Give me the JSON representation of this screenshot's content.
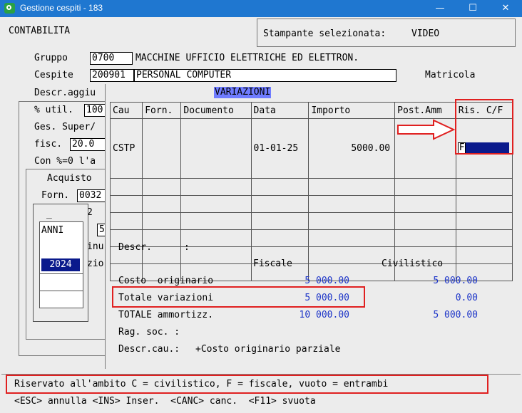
{
  "window": {
    "title": "Gestione cespiti - 183",
    "minimize_glyph": "—",
    "maximize_glyph": "☐",
    "close_glyph": "✕"
  },
  "header": {
    "section": "CONTABILITA",
    "printer_label": "Stampante selezionata:",
    "printer_value": "VIDEO"
  },
  "form": {
    "gruppo_label": "Gruppo",
    "gruppo_code": "0700",
    "gruppo_desc": "MACCHINE UFFICIO ELETTRICHE ED ELETTRON.",
    "cespite_label": "Cespite",
    "cespite_code": "200901",
    "cespite_desc": "PERSONAL COMPUTER",
    "matricola_label": "Matricola",
    "descr_agg_label": "Descr.aggiu",
    "util_label": "% util.",
    "util_value": "100",
    "ges_super_label": "Ges. Super/",
    "fisc_label": "fisc.",
    "fisc_value": "20.0",
    "con_label": "Con %=0 l'a",
    "acquisto_label": "Acquisto",
    "forn_label": "Forn.",
    "forn_value": "0032",
    "frag_2": "2",
    "frag_5": "5",
    "frag_inu": "inu",
    "frag_zio": "zio"
  },
  "anni": {
    "dash": "_",
    "header": "ANNI",
    "selected": "2024"
  },
  "variazioni": {
    "title": "VARIAZIONI",
    "columns": [
      "Cau",
      "Forn.",
      "Documento",
      "Data",
      "Importo",
      "Post.Amm",
      "Ris. C/F"
    ],
    "rows": [
      {
        "cau": "CSTP",
        "forn": "",
        "documento": "",
        "data": "01-01-25",
        "importo": "5000.00",
        "post": "",
        "ris": "F"
      }
    ],
    "descr_label": "Descr.",
    "descr_colon": ":",
    "col_fiscale": "Fiscale",
    "col_civilistico": "Civilistico",
    "summary": [
      {
        "label": "Costo  originario",
        "fiscale": "5 000.00",
        "civilistico": "5 000.00"
      },
      {
        "label": "Totale variazioni",
        "fiscale": "5 000.00",
        "civilistico": "0.00"
      },
      {
        "label": "TOTALE ammortizz.",
        "fiscale": "10 000.00",
        "civilistico": "5 000.00"
      }
    ],
    "rag_soc_label": "Rag. soc. :",
    "descr_cau_label": "Descr.cau.:",
    "descr_cau_value": "+Costo originario parziale"
  },
  "status": {
    "hint": "Riservato all'ambito C = civilistico, F = fiscale, vuoto = entrambi",
    "keys": "<ESC> annulla <INS> Inser.  <CANC> canc.  <F11> svuota"
  },
  "colors": {
    "titlebar": "#1f77d0",
    "selection": "#0a1a8c",
    "value_blue": "#1d35c8",
    "highlight_red": "#e02020",
    "arrow": "#e02020"
  }
}
